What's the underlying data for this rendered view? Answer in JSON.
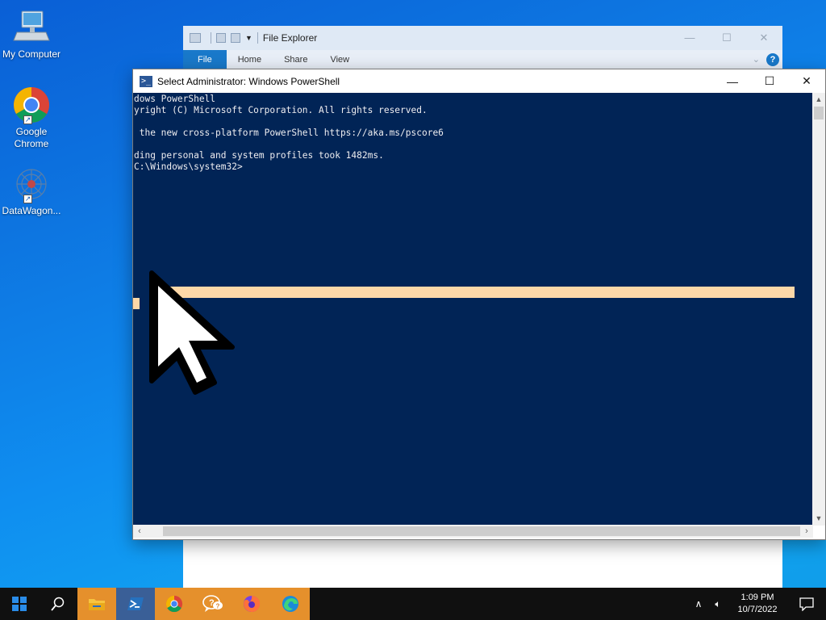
{
  "desktop": {
    "icons": [
      {
        "label": "My Computer",
        "icon": "computer-icon"
      },
      {
        "label": "Google Chrome",
        "icon": "chrome-icon"
      },
      {
        "label": "DataWagon...",
        "icon": "datawagon-icon"
      }
    ]
  },
  "file_explorer": {
    "title": "File Explorer",
    "tabs": [
      "File",
      "Home",
      "Share",
      "View"
    ],
    "help_label": "?"
  },
  "powershell": {
    "title": "Select Administrator: Windows PowerShell",
    "console_lines": [
      "dows PowerShell",
      "yright (C) Microsoft Corporation. All rights reserved.",
      "",
      " the new cross-platform PowerShell https://aka.ms/pscore6",
      "",
      "ding personal and system profiles took 1482ms.",
      "C:\\Windows\\system32>"
    ],
    "selection_color": "#fdd8a8",
    "background_color": "#012456"
  },
  "taskbar": {
    "apps": [
      {
        "name": "start-icon"
      },
      {
        "name": "search-icon"
      },
      {
        "name": "file-explorer-icon"
      },
      {
        "name": "powershell-icon"
      },
      {
        "name": "chrome-icon"
      },
      {
        "name": "help-icon"
      },
      {
        "name": "firefox-icon"
      },
      {
        "name": "edge-icon"
      }
    ],
    "time": "1:09 PM",
    "date": "10/7/2022"
  }
}
